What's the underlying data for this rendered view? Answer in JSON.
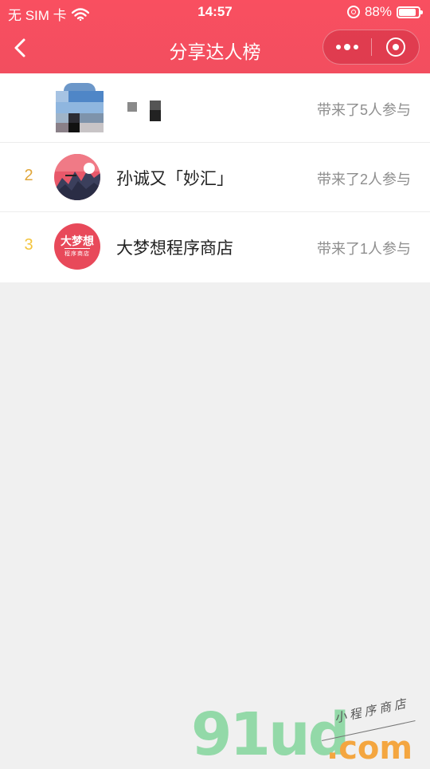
{
  "status_bar": {
    "carrier": "无 SIM 卡",
    "time": "14:57",
    "battery": "88%",
    "battery_level": 0.88
  },
  "nav": {
    "title": "分享达人榜",
    "back_icon": "chevron-left-icon",
    "more_icon": "more-dots-icon",
    "close_icon": "target-close-icon"
  },
  "ranking": [
    {
      "rank": "",
      "name": "",
      "count_text": "带来了5人参与"
    },
    {
      "rank": "2",
      "name": "孙诚又「妙汇」",
      "count_text": "带来了2人参与"
    },
    {
      "rank": "3",
      "name": "大梦想程序商店",
      "count_text": "带来了1人参与"
    }
  ],
  "avatar_logo_text": {
    "main": "大梦想",
    "sub": "程序商店"
  },
  "watermark": {
    "brand": "91ud",
    "domain": ".com",
    "tagline": "小程序商店"
  },
  "colors": {
    "header": "#f94f60",
    "rank2": "#e0a63a",
    "rank3": "#f3c43c",
    "watermark_green": "#93d9a8",
    "watermark_orange": "#f4a640"
  }
}
